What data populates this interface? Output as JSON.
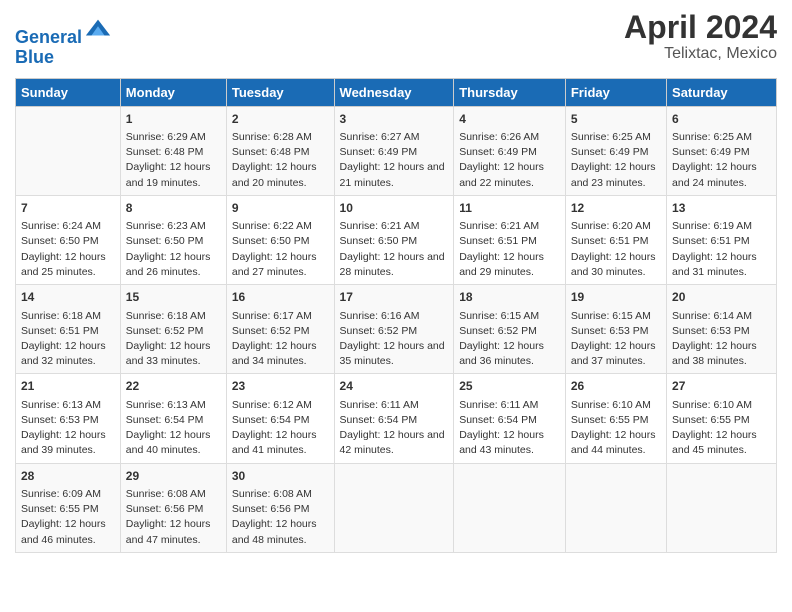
{
  "header": {
    "logo_line1": "General",
    "logo_line2": "Blue",
    "title": "April 2024",
    "subtitle": "Telixtac, Mexico"
  },
  "days_of_week": [
    "Sunday",
    "Monday",
    "Tuesday",
    "Wednesday",
    "Thursday",
    "Friday",
    "Saturday"
  ],
  "weeks": [
    [
      {
        "day": "",
        "info": ""
      },
      {
        "day": "1",
        "info": "Sunrise: 6:29 AM\nSunset: 6:48 PM\nDaylight: 12 hours and 19 minutes."
      },
      {
        "day": "2",
        "info": "Sunrise: 6:28 AM\nSunset: 6:48 PM\nDaylight: 12 hours and 20 minutes."
      },
      {
        "day": "3",
        "info": "Sunrise: 6:27 AM\nSunset: 6:49 PM\nDaylight: 12 hours and 21 minutes."
      },
      {
        "day": "4",
        "info": "Sunrise: 6:26 AM\nSunset: 6:49 PM\nDaylight: 12 hours and 22 minutes."
      },
      {
        "day": "5",
        "info": "Sunrise: 6:25 AM\nSunset: 6:49 PM\nDaylight: 12 hours and 23 minutes."
      },
      {
        "day": "6",
        "info": "Sunrise: 6:25 AM\nSunset: 6:49 PM\nDaylight: 12 hours and 24 minutes."
      }
    ],
    [
      {
        "day": "7",
        "info": "Sunrise: 6:24 AM\nSunset: 6:50 PM\nDaylight: 12 hours and 25 minutes."
      },
      {
        "day": "8",
        "info": "Sunrise: 6:23 AM\nSunset: 6:50 PM\nDaylight: 12 hours and 26 minutes."
      },
      {
        "day": "9",
        "info": "Sunrise: 6:22 AM\nSunset: 6:50 PM\nDaylight: 12 hours and 27 minutes."
      },
      {
        "day": "10",
        "info": "Sunrise: 6:21 AM\nSunset: 6:50 PM\nDaylight: 12 hours and 28 minutes."
      },
      {
        "day": "11",
        "info": "Sunrise: 6:21 AM\nSunset: 6:51 PM\nDaylight: 12 hours and 29 minutes."
      },
      {
        "day": "12",
        "info": "Sunrise: 6:20 AM\nSunset: 6:51 PM\nDaylight: 12 hours and 30 minutes."
      },
      {
        "day": "13",
        "info": "Sunrise: 6:19 AM\nSunset: 6:51 PM\nDaylight: 12 hours and 31 minutes."
      }
    ],
    [
      {
        "day": "14",
        "info": "Sunrise: 6:18 AM\nSunset: 6:51 PM\nDaylight: 12 hours and 32 minutes."
      },
      {
        "day": "15",
        "info": "Sunrise: 6:18 AM\nSunset: 6:52 PM\nDaylight: 12 hours and 33 minutes."
      },
      {
        "day": "16",
        "info": "Sunrise: 6:17 AM\nSunset: 6:52 PM\nDaylight: 12 hours and 34 minutes."
      },
      {
        "day": "17",
        "info": "Sunrise: 6:16 AM\nSunset: 6:52 PM\nDaylight: 12 hours and 35 minutes."
      },
      {
        "day": "18",
        "info": "Sunrise: 6:15 AM\nSunset: 6:52 PM\nDaylight: 12 hours and 36 minutes."
      },
      {
        "day": "19",
        "info": "Sunrise: 6:15 AM\nSunset: 6:53 PM\nDaylight: 12 hours and 37 minutes."
      },
      {
        "day": "20",
        "info": "Sunrise: 6:14 AM\nSunset: 6:53 PM\nDaylight: 12 hours and 38 minutes."
      }
    ],
    [
      {
        "day": "21",
        "info": "Sunrise: 6:13 AM\nSunset: 6:53 PM\nDaylight: 12 hours and 39 minutes."
      },
      {
        "day": "22",
        "info": "Sunrise: 6:13 AM\nSunset: 6:54 PM\nDaylight: 12 hours and 40 minutes."
      },
      {
        "day": "23",
        "info": "Sunrise: 6:12 AM\nSunset: 6:54 PM\nDaylight: 12 hours and 41 minutes."
      },
      {
        "day": "24",
        "info": "Sunrise: 6:11 AM\nSunset: 6:54 PM\nDaylight: 12 hours and 42 minutes."
      },
      {
        "day": "25",
        "info": "Sunrise: 6:11 AM\nSunset: 6:54 PM\nDaylight: 12 hours and 43 minutes."
      },
      {
        "day": "26",
        "info": "Sunrise: 6:10 AM\nSunset: 6:55 PM\nDaylight: 12 hours and 44 minutes."
      },
      {
        "day": "27",
        "info": "Sunrise: 6:10 AM\nSunset: 6:55 PM\nDaylight: 12 hours and 45 minutes."
      }
    ],
    [
      {
        "day": "28",
        "info": "Sunrise: 6:09 AM\nSunset: 6:55 PM\nDaylight: 12 hours and 46 minutes."
      },
      {
        "day": "29",
        "info": "Sunrise: 6:08 AM\nSunset: 6:56 PM\nDaylight: 12 hours and 47 minutes."
      },
      {
        "day": "30",
        "info": "Sunrise: 6:08 AM\nSunset: 6:56 PM\nDaylight: 12 hours and 48 minutes."
      },
      {
        "day": "",
        "info": ""
      },
      {
        "day": "",
        "info": ""
      },
      {
        "day": "",
        "info": ""
      },
      {
        "day": "",
        "info": ""
      }
    ]
  ]
}
